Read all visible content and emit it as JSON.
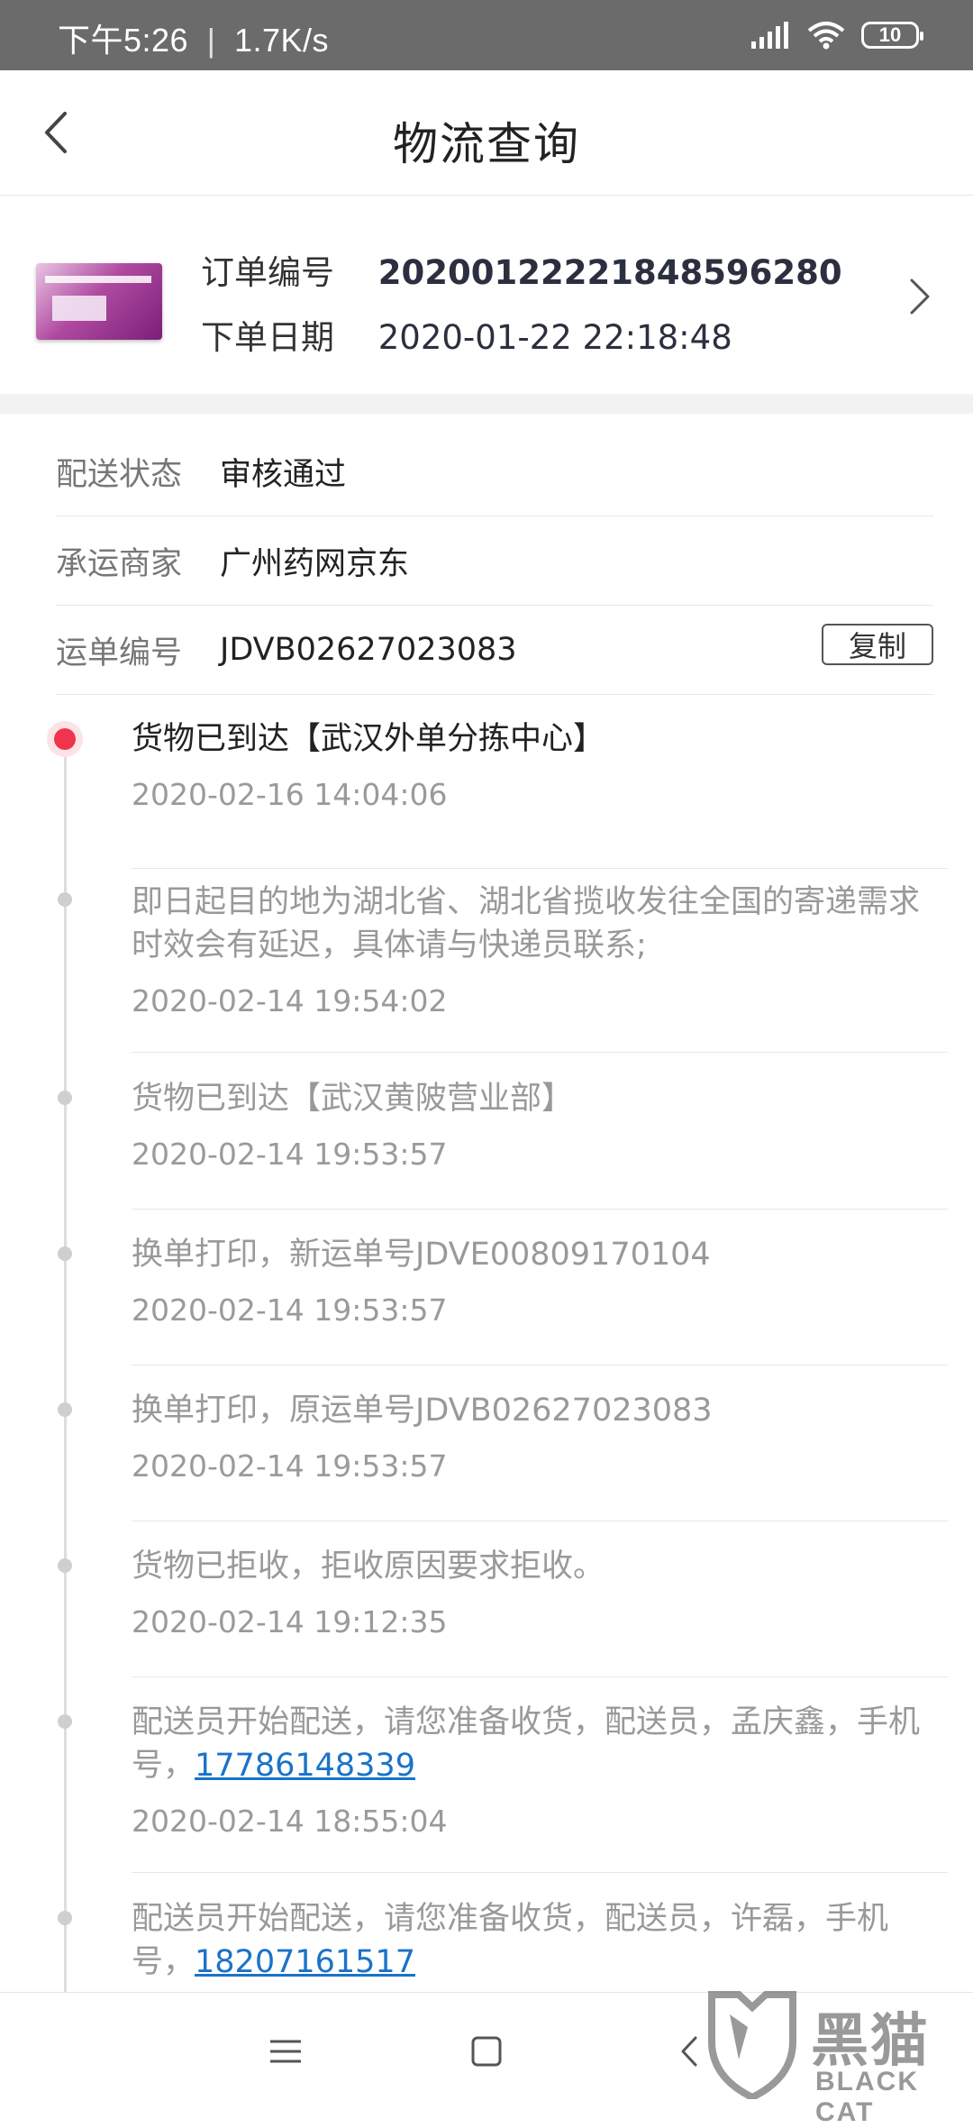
{
  "status_bar": {
    "time": "下午5:26",
    "separator": "|",
    "speed": "1.7K/s",
    "battery": "10"
  },
  "header": {
    "title": "物流查询"
  },
  "order": {
    "number_label": "订单编号",
    "number_value": "20200122221848596280",
    "date_label": "下单日期",
    "date_value": "2020-01-22 22:18:48"
  },
  "info": {
    "status_label": "配送状态",
    "status_value": "审核通过",
    "carrier_label": "承运商家",
    "carrier_value": "广州药网京东",
    "waybill_label": "运单编号",
    "waybill_value": "JDVB02627023083",
    "copy_label": "复制"
  },
  "timeline": [
    {
      "text": "货物已到达【武汉外单分拣中心】",
      "time": "2020-02-16 14:04:06"
    },
    {
      "text": "即日起目的地为湖北省、湖北省揽收发往全国的寄递需求时效会有延迟，具体请与快递员联系;",
      "time": "2020-02-14 19:54:02"
    },
    {
      "text": "货物已到达【武汉黄陂营业部】",
      "time": "2020-02-14 19:53:57"
    },
    {
      "text": "换单打印，新运单号JDVE00809170104",
      "time": "2020-02-14 19:53:57"
    },
    {
      "text": "换单打印，原运单号JDVB02627023083",
      "time": "2020-02-14 19:53:57"
    },
    {
      "text": "货物已拒收，拒收原因要求拒收。",
      "time": "2020-02-14 19:12:35"
    },
    {
      "text": "配送员开始配送，请您准备收货，配送员，孟庆鑫，手机号，",
      "phone": "17786148339",
      "time": "2020-02-14 18:55:04"
    },
    {
      "text": "配送员开始配送，请您准备收货，配送员，许磊，手机号，",
      "phone": "18207161517",
      "time": ""
    }
  ],
  "watermark": {
    "text": "黑猫",
    "sub": "BLACK CAT"
  }
}
